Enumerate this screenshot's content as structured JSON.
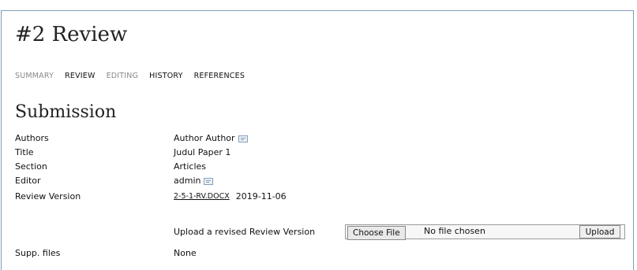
{
  "page": {
    "title": "#2 Review"
  },
  "tabs": [
    {
      "label": "SUMMARY",
      "active": false
    },
    {
      "label": "REVIEW",
      "active": true
    },
    {
      "label": "EDITING",
      "active": false
    },
    {
      "label": "HISTORY",
      "active": true
    },
    {
      "label": "REFERENCES",
      "active": true
    }
  ],
  "submission": {
    "heading": "Submission",
    "rows": {
      "authors": {
        "label": "Authors",
        "value": "Author Author",
        "icon": "mail-icon"
      },
      "title": {
        "label": "Title",
        "value": "Judul Paper 1"
      },
      "section": {
        "label": "Section",
        "value": "Articles"
      },
      "editor": {
        "label": "Editor",
        "value": "admin",
        "icon": "mail-icon"
      },
      "review_version": {
        "label": "Review Version",
        "file": "2-5-1-RV.DOCX",
        "date": "2019-11-06"
      },
      "supp_files": {
        "label": "Supp. files",
        "value": "None"
      }
    },
    "upload": {
      "label": "Upload a revised Review Version",
      "choose_button": "Choose File",
      "no_file_text": "No file chosen",
      "upload_button": "Upload"
    }
  },
  "colors": {
    "frame_border": "#7f9db9",
    "muted_tab": "#888888"
  }
}
